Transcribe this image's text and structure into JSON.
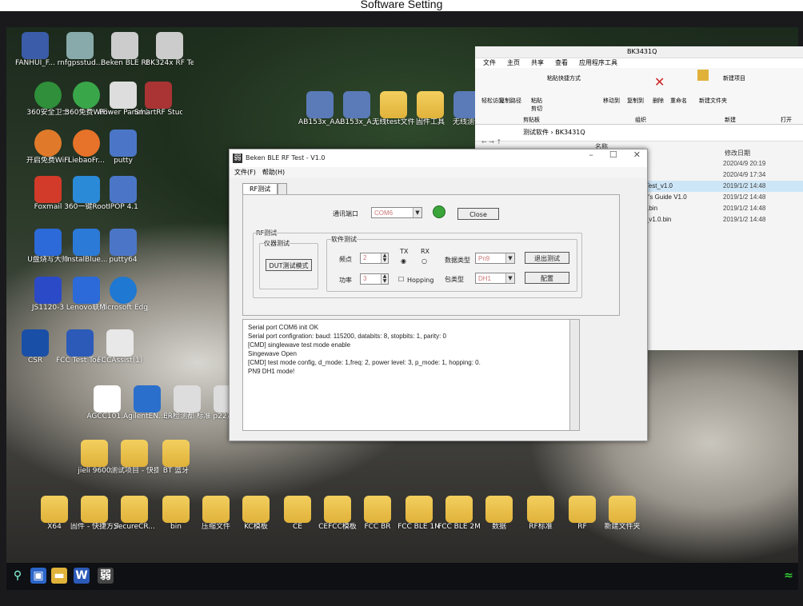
{
  "page_title": "Software Setting",
  "desktop_icons": [
    {
      "label": "FANHUI_F..."
    },
    {
      "label": "rnfgpsstud..."
    },
    {
      "label": "Beken BLE RF Test_v1.0"
    },
    {
      "label": "BK324x RF Test_V1.8..."
    },
    {
      "label": "360安全卫士"
    },
    {
      "label": "360免费WiFi"
    },
    {
      "label": "Power Panel 3.0"
    },
    {
      "label": "SmartRF Studio 7"
    },
    {
      "label": "开启免费WiFi"
    },
    {
      "label": "LiebaoFr..."
    },
    {
      "label": "putty"
    },
    {
      "label": "Foxmail"
    },
    {
      "label": "360一键Root"
    },
    {
      "label": "IPOP 4.1"
    },
    {
      "label": "U盘烧写大师"
    },
    {
      "label": "InstalBlue..."
    },
    {
      "label": "putty64"
    },
    {
      "label": "JS1120-3"
    },
    {
      "label": "Lenovo联想"
    },
    {
      "label": "Microsoft Edge"
    },
    {
      "label": "CSR"
    },
    {
      "label": "FCC Test Tool.exe"
    },
    {
      "label": "FCCAssist(1)"
    },
    {
      "label": "AGCC101..."
    },
    {
      "label": "AgilentEN...快捷方式"
    },
    {
      "label": "ER检测都 标准工时-20..."
    },
    {
      "label": "p22定制"
    },
    {
      "label": "jieli 9600"
    },
    {
      "label": "测试项目 - 快捷方式"
    },
    {
      "label": "BT 蓝牙"
    },
    {
      "label": "X64"
    },
    {
      "label": "固件 - 快捷方式"
    },
    {
      "label": "SecureCR..."
    },
    {
      "label": "bin"
    },
    {
      "label": "压缩文件"
    },
    {
      "label": "KC模板"
    },
    {
      "label": "CE"
    },
    {
      "label": "CEFCC模板"
    },
    {
      "label": "FCC BR"
    },
    {
      "label": "FCC BLE 1M"
    },
    {
      "label": "FCC BLE 2M"
    },
    {
      "label": "数据"
    },
    {
      "label": "RF标准"
    },
    {
      "label": "RF"
    },
    {
      "label": "新建文件夹"
    }
  ],
  "top_icons": [
    {
      "label": "AB153x_A..."
    },
    {
      "label": "AB153x_A..."
    },
    {
      "label": "无线test文件"
    },
    {
      "label": "固件工具"
    },
    {
      "label": "无线测试"
    }
  ],
  "explorer": {
    "tabs": [
      "文件",
      "主页",
      "共享",
      "查看",
      "应用程序工具"
    ],
    "title": "BK3431Q",
    "ribbon": {
      "paste": "粘贴",
      "copy_path": "复制路径",
      "paste_shortcut": "粘贴快捷方式",
      "cut": "剪切",
      "move_to": "移动到",
      "copy_to": "复制到",
      "delete": "删除",
      "rename": "重命名",
      "new_folder": "新建文件夹",
      "new_item": "新建项目",
      "easy_access": "轻松访问",
      "clipboard": "剪贴板",
      "organize": "组织",
      "new": "新建",
      "open": "打开"
    },
    "breadcrumb": "测试软件 › BK3431Q",
    "col_name": "名称",
    "col_date": "修改日期",
    "files": [
      {
        "name": "",
        "date": "2020/4/9 20:19"
      },
      {
        "name": "",
        "date": "2020/4/9 17:34"
      },
      {
        "name": "RF Test_v1.0",
        "date": "2019/1/2 14:48"
      },
      {
        "name": "User's Guide V1.0",
        "date": "2019/1/2 14:48"
      },
      {
        "name": "_crc.bin",
        "date": "2019/1/2 14:48"
      },
      {
        "name": "test_v1.0.bin",
        "date": "2019/1/2 14:48"
      }
    ]
  },
  "beken": {
    "title": "Beken BLE RF Test - V1.0",
    "menu": [
      "文件(F)",
      "帮助(H)"
    ],
    "tab_label": "RF测试",
    "port_label": "通讯端口",
    "port_value": "COM6",
    "close_label": "Close",
    "rf_group_label": "RF测试",
    "instrument_group_label": "仪器测试",
    "dut_button": "DUT测试模式",
    "software_group_label": "软件测试",
    "freq_label": "频点",
    "freq_value": "2",
    "power_label": "功率",
    "power_value": "3",
    "tx_label": "TX",
    "rx_label": "RX",
    "hopping_label": "Hopping",
    "datatype_label": "数据类型",
    "datatype_value": "Pn9",
    "packettype_label": "包类型",
    "packettype_value": "DH1",
    "exit_test_button": "退出测试",
    "config_button": "配置",
    "log": [
      "Serial port COM6 init OK",
      "Serial port configration: baud: 115200, databits: 8, stopbits: 1, parity: 0",
      "[CMD] singlewave test mode enable",
      "Singewave Open",
      "[CMD] test mode config, d_mode: 1,freq: 2, power level: 3, p_mode: 1, hopping: 0.",
      "PN9 DH1 mode!"
    ]
  },
  "colors": {
    "status_led": "#3aa63a",
    "accent_combo_text": "#c77"
  }
}
